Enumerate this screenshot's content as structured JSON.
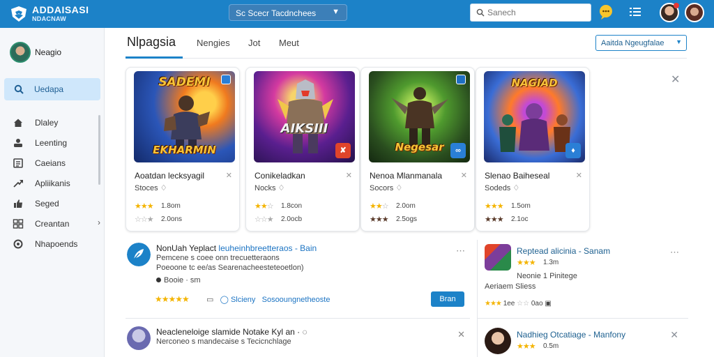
{
  "app": {
    "name": "ADDAISASI",
    "subtitle": "NDACNAW"
  },
  "topbar": {
    "category_select": "Sc Scecr Tacdnchees",
    "search_placeholder": "Sanech"
  },
  "sidebar": {
    "profile_name": "Neagio",
    "search_label": "Uedapa",
    "items": [
      {
        "label": "Dlaley"
      },
      {
        "label": "Leenting"
      },
      {
        "label": "Caeians"
      },
      {
        "label": "Apliikanis"
      },
      {
        "label": "Seged"
      },
      {
        "label": "Creantan"
      },
      {
        "label": "Nhapoends"
      }
    ]
  },
  "tabs": {
    "items": [
      "Nlpagsia",
      "Nengies",
      "Jot",
      "Meut"
    ],
    "sort_select": "Aaitda Ngeugfalae"
  },
  "cards": [
    {
      "art_top": "SADEMI",
      "art_bottom": "EKHARMIN",
      "title": "Aoatdan lecksyagil",
      "subtitle": "Stoces",
      "rating_count": "1.8om",
      "sub_count": "2.0ons",
      "stars_filled": 3
    },
    {
      "art_top": "",
      "art_bottom": "AIKSIII",
      "title": "Conikeladkan",
      "subtitle": "Nocks",
      "rating_count": "1.8con",
      "sub_count": "2.0ocb",
      "stars_filled": 2
    },
    {
      "art_top": "",
      "art_bottom": "Negesar",
      "title": "Nenoa Mlanmanala",
      "subtitle": "Socors",
      "rating_count": "2.0om",
      "sub_count": "2.5ogs",
      "stars_filled": 2
    },
    {
      "art_top": "NAGIAD",
      "art_bottom": "",
      "title": "Slenao Baiheseal",
      "subtitle": "Sodeds",
      "rating_count": "1.5om",
      "sub_count": "2.1oc",
      "stars_filled": 3
    }
  ],
  "list_left": [
    {
      "title_a": "NonUah Yeplact",
      "title_b": "leuheinhbreetteraos",
      "title_c": "- Bain",
      "line2": "Pemcene s coee onn trecuetteraons",
      "line3": "Poeoone tc ee/as Searenacheesteteoetlon)",
      "line4": "Booie · sm",
      "meta_a": "",
      "meta_b": "Slcieny",
      "meta_c": "Sosooungnetheoste",
      "button": "Bran"
    },
    {
      "title_a": "Neacleneloige slamide Notake Kyl",
      "title_b": "",
      "title_c": "an",
      "line2": "Nerconeo s mandecaise s Tecicnchlage",
      "line3": "",
      "line4": "",
      "meta_a": "",
      "meta_b": "",
      "meta_c": "",
      "button": ""
    }
  ],
  "list_right": [
    {
      "title": "Reptead alicinia - Sanam",
      "count": "1.3m",
      "line3": "Neonie 1 Pinitege",
      "line4": "Aeriaem Sliess",
      "bottom_count": "1ee",
      "bottom_count2": "0ao"
    },
    {
      "title": "Nadhieg Otcatiage - Manfony",
      "count": "0.5m",
      "line3": "",
      "line4": "",
      "bottom_count": "",
      "bottom_count2": ""
    }
  ],
  "colors": {
    "brand": "#1c82c8",
    "accent_light": "#cfe7fb",
    "star": "#f4b400"
  }
}
